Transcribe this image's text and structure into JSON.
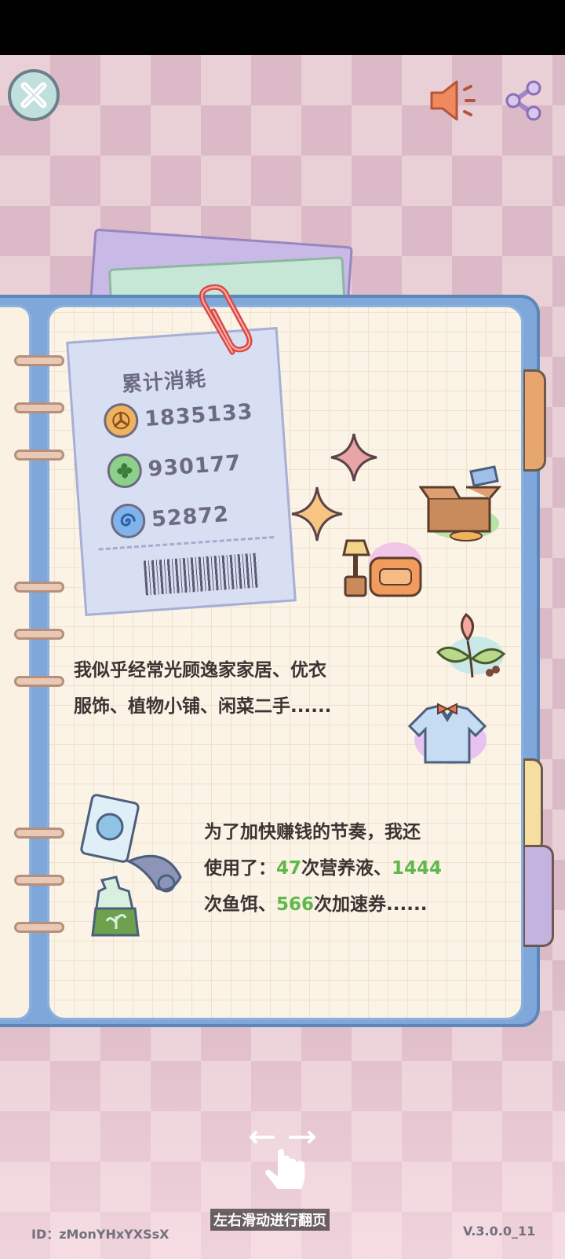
{
  "receipt": {
    "title": "累计消耗",
    "stats": [
      {
        "icon": "orange-coin-icon",
        "value": "1835133"
      },
      {
        "icon": "green-leaf-coin-icon",
        "value": "930177"
      },
      {
        "icon": "blue-swirl-coin-icon",
        "value": "52872"
      }
    ]
  },
  "paragraph1": {
    "line1": "我似乎经常光顾逸家家居、优衣",
    "line2": "服饰、植物小铺、闲菜二手......"
  },
  "paragraph2": {
    "line1": "为了加快赚钱的节奏，我还",
    "line2_pre": "使用了：",
    "nutrient_count": "47",
    "line2_mid": "次营养液、",
    "bait_count": "1444",
    "line3_pre": "次鱼饵、",
    "booster_count": "566",
    "line3_post": "次加速券......"
  },
  "footer": {
    "id": "ID：zMonYHxYXSsX",
    "version": "V.3.0.0_11",
    "swipe_hint": "左右滑动进行翻页"
  },
  "colors": {
    "highlight": "#5fb84a",
    "notebook_border": "#7fa7d9",
    "background_check": "#dcb9c6"
  }
}
